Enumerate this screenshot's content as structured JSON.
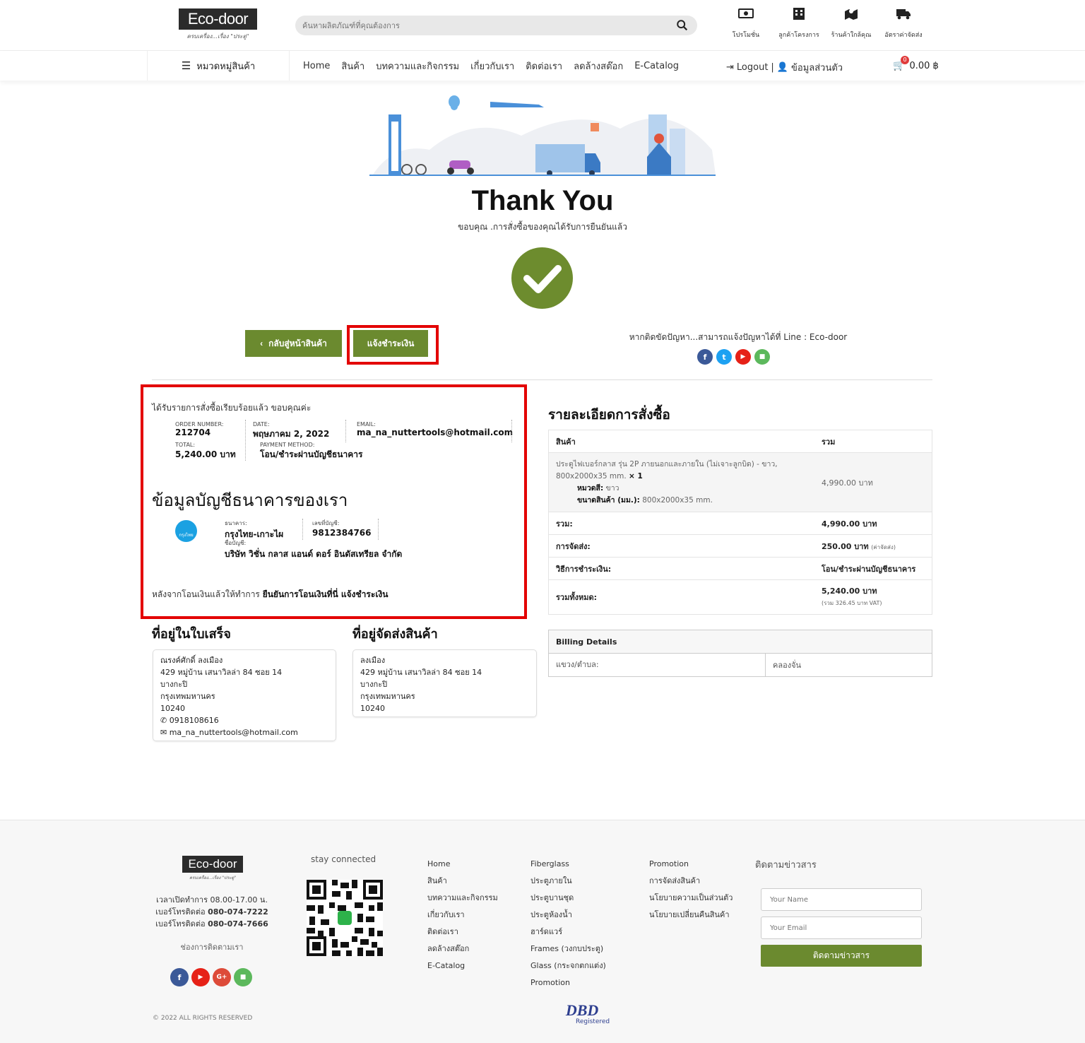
{
  "header": {
    "logo_text": "Eco-door",
    "logo_tagline": "ครบเครื่อง...เรื่อง \"ประตู\"",
    "search_placeholder": "ค้นหาผลิตภัณฑ์ที่คุณต้องการ",
    "quick_links": [
      {
        "label": "โปรโมชั่น",
        "icon": "money-icon"
      },
      {
        "label": "ลูกค้าโครงการ",
        "icon": "building-icon"
      },
      {
        "label": "ร้านค้าใกล้คุณ",
        "icon": "map-icon"
      },
      {
        "label": "อัตราค่าจัดส่ง",
        "icon": "truck-icon"
      }
    ],
    "category_label": "หมวดหมู่สินค้า",
    "nav": [
      "Home",
      "สินค้า",
      "บทความและกิจกรรม",
      "เกี่ยวกับเรา",
      "ติดต่อเรา",
      "ลดล้างสต๊อก",
      "E-Catalog"
    ],
    "logout": "Logout",
    "separator": "|",
    "profile": "ข้อมูลส่วนตัว",
    "cart_count": "0",
    "cart_total": "0.00 ฿"
  },
  "hero": {
    "title": "Thank You",
    "subtitle": "ขอบคุณ .การสั่งซื้อของคุณได้รับการยืนยันแล้ว"
  },
  "buttons": {
    "back": "กลับสู่หน้าสินค้า",
    "notify_payment": "แจ้งชำระเงิน"
  },
  "help_text": "หากติดขัดปัญหา...สามารถแจ้งปัญหาได้ที่ Line : Eco-door",
  "social_top": [
    {
      "name": "facebook",
      "glyph": "f",
      "color": "#3b5998"
    },
    {
      "name": "twitter",
      "glyph": "t",
      "color": "#1da1f2"
    },
    {
      "name": "youtube",
      "glyph": "▶",
      "color": "#e62117"
    },
    {
      "name": "line",
      "glyph": "■",
      "color": "#5cb85c"
    }
  ],
  "order": {
    "received": "ได้รับรายการสั่งซื้อเรียบร้อยแล้ว ขอบคุณค่ะ",
    "order_number_label": "ORDER NUMBER:",
    "order_number": "212704",
    "date_label": "DATE:",
    "date": "พฤษภาคม 2, 2022",
    "email_label": "EMAIL:",
    "email": "ma_na_nuttertools@hotmail.com",
    "total_label": "TOTAL:",
    "total": "5,240.00 บาท",
    "payment_label": "PAYMENT METHOD:",
    "payment": "โอน/ชำระผ่านบัญชีธนาคาร"
  },
  "bank": {
    "title": "ข้อมูลบัญชีธนาคารของเรา",
    "bank_label": "ธนาคาร:",
    "bank_name": "กรุงไทย-เกาะไผ",
    "account_no_label": "เลขที่บัญชี:",
    "account_no": "9812384766",
    "account_name_label": "ชื่อบัญชี:",
    "account_name": "บริษัท วิชั่น กลาส แอนด์ ดอร์ อินดัสเทรียล จำกัด",
    "logo_text": "กรุงไทย",
    "transfer_note_prefix": "หลังจากโอนเงินแล้วให้ทำการ ",
    "transfer_note_bold": "ยืนยันการโอนเงินที่นี่ แจ้งชำระเงิน"
  },
  "details": {
    "title": "รายละเอียดการสั่งซื้อ",
    "col_product": "สินค้า",
    "col_total": "รวม",
    "item_name": "ประตูไฟเบอร์กลาส รุ่น 2P ภายนอกและภายใน (ไม่เจาะลูกบิด) - ขาว, 800x2000x35 mm.",
    "item_qty": "× 1",
    "item_color_label": "หมวดสี:",
    "item_color": "ขาว",
    "item_size_label": "ขนาดสินค้า (มม.):",
    "item_size": "800x2000x35 mm.",
    "item_total": "4,990.00 บาท",
    "subtotal_label": "รวม:",
    "subtotal": "4,990.00 บาท",
    "shipping_label": "การจัดส่ง:",
    "shipping": "250.00 บาท",
    "shipping_note": "(ค่าจัดส่ง)",
    "method_label": "วิธีการชำระเงิน:",
    "method": "โอน/ชำระผ่านบัญชีธนาคาร",
    "grand_label": "รวมทั้งหมด:",
    "grand": "5,240.00 บาท",
    "grand_note": "(รวม 326.45 บาท VAT)"
  },
  "billing": {
    "title": "Billing Details",
    "district_label": "แขวง/ตำบล:",
    "district": "คลองจั่น"
  },
  "invoice_address": {
    "title": "ที่อยู่ในใบเสร็จ",
    "name": "ณรงค์ศักดิ์ ลงเมือง",
    "line1": "429 หมู่บ้าน เสนาวิลล่า 84 ซอย 14",
    "line2": "บางกะปิ",
    "line3": "กรุงเทพมหานคร",
    "zip": "10240",
    "phone": "0918108616",
    "email": "ma_na_nuttertools@hotmail.com"
  },
  "shipping_address": {
    "title": "ที่อยู่จัดส่งสินค้า",
    "name": "ลงเมือง",
    "line1": "429 หมู่บ้าน เสนาวิลล่า 84 ซอย 14",
    "line2": "บางกะปิ",
    "line3": "กรุงเทพมหานคร",
    "zip": "10240"
  },
  "footer": {
    "hours": "เวลาเปิดทำการ 08.00-17.00 น.",
    "phone_label": "เบอร์โทรติดต่อ",
    "phone1": "080-074-7222",
    "phone2": "080-074-7666",
    "contact_channel": "ช่องการติดตามเรา",
    "stay_connected": "stay connected",
    "col1": [
      "Home",
      "สินค้า",
      "บทความและกิจกรรม",
      "เกี่ยวกับเรา",
      "ติดต่อเรา",
      "ลดล้างสต๊อก",
      "E-Catalog"
    ],
    "col2": [
      "Fiberglass",
      "ประตูภายใน",
      "ประตูบานชุด",
      "ประตูห้องน้ำ",
      "ฮาร์ดแวร์",
      "Frames (วงกบประตู)",
      "Glass (กระจกตกแต่ง)",
      "Promotion"
    ],
    "col3": [
      "Promotion",
      "การจัดส่งสินค้า",
      "นโยบายความเป็นส่วนตัว",
      "นโยบายเปลี่ยนคืนสินค้า"
    ],
    "newsletter_title": "ติดตามข่าวสาร",
    "name_placeholder": "Your Name",
    "email_placeholder": "Your Email",
    "subscribe": "ติดตามข่าวสาร",
    "copyright": "© 2022 ALL RIGHTS RESERVED",
    "dbd": "DBD",
    "dbd_sub": "Registered",
    "social": [
      {
        "name": "facebook",
        "glyph": "f",
        "color": "#3b5998"
      },
      {
        "name": "youtube",
        "glyph": "▶",
        "color": "#e62117"
      },
      {
        "name": "google-plus",
        "glyph": "G+",
        "color": "#dd4b39"
      },
      {
        "name": "line",
        "glyph": "■",
        "color": "#5cb85c"
      }
    ]
  },
  "colors": {
    "accent": "#6b8a2f",
    "highlight": "#e30000"
  }
}
